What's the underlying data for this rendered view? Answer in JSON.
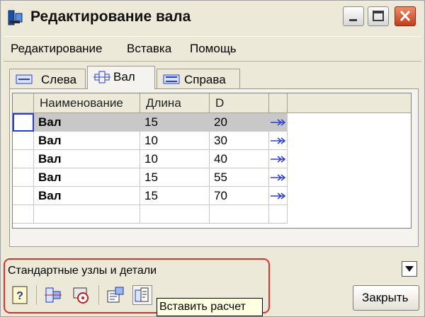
{
  "window": {
    "title": "Редактирование вала"
  },
  "menu": [
    "Редактирование",
    "Вставка",
    "Помощь"
  ],
  "tabs": [
    {
      "label": "Слева",
      "active": false
    },
    {
      "label": "Вал",
      "active": true
    },
    {
      "label": "Справа",
      "active": false
    }
  ],
  "table": {
    "columns": [
      "Наименование",
      "Длина",
      "D"
    ],
    "rows": [
      {
        "name": "Вал",
        "length": "15",
        "d": "20",
        "selected": true
      },
      {
        "name": "Вал",
        "length": "10",
        "d": "30",
        "selected": false
      },
      {
        "name": "Вал",
        "length": "10",
        "d": "40",
        "selected": false
      },
      {
        "name": "Вал",
        "length": "15",
        "d": "55",
        "selected": false
      },
      {
        "name": "Вал",
        "length": "15",
        "d": "70",
        "selected": false
      }
    ]
  },
  "bottom": {
    "section_label": "Стандартные узлы и детали",
    "tooltip": "Вставить расчет",
    "close_label": "Закрыть"
  },
  "colors": {
    "highlight": "#e0302a",
    "row_arrow": "#2a3bd8",
    "selected_row": "#c8c8c8"
  }
}
